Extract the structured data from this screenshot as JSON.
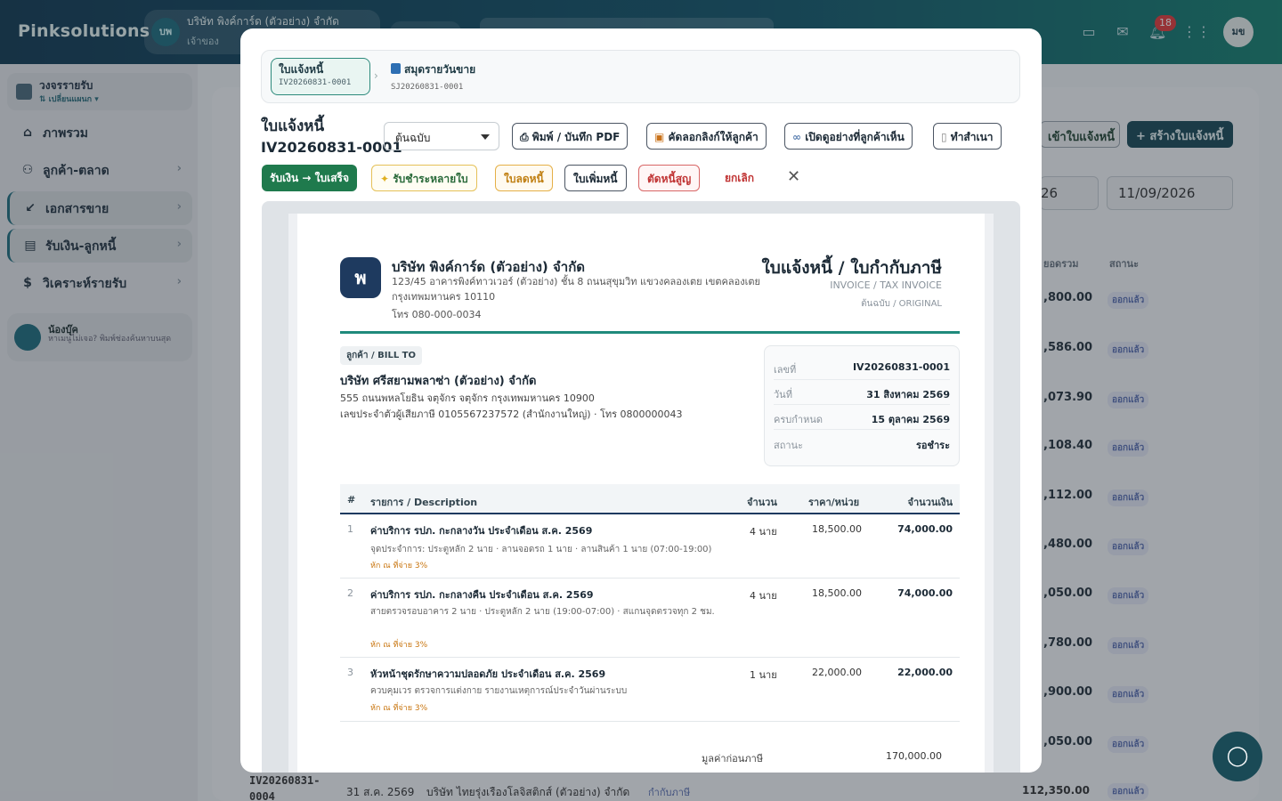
{
  "app": {
    "brand": "Pinksolutions",
    "company_avatar": "บพ",
    "company_name": "บริษัท พิงค์การ์ด (ตัวอย่าง) จำกัด",
    "company_role": "เจ้าของ",
    "notification_count": "18",
    "user_avatar": "มข"
  },
  "sidebar": {
    "plan_title": "วงจรรายรับ",
    "plan_switch": "⇅ เปลี่ยนแผนก ▾",
    "items": [
      {
        "label": "ภาพรวม",
        "icon": "home-icon"
      },
      {
        "label": "ลูกค้า-ตลาด",
        "icon": "users-icon"
      },
      {
        "label": "เอกสารขาย",
        "icon": "arrow-down-left-icon"
      },
      {
        "label": "รับเงิน-ลูกหนี้",
        "icon": "receipt-icon"
      },
      {
        "label": "วิเคราะห์รายรับ",
        "icon": "dollar-doc-icon"
      }
    ],
    "help_title": "น้องบุ๊ค",
    "help_sub": "หาเมนูไม่เจอ? พิมพ์ช่องค้นหาบนสุด"
  },
  "background": {
    "btn_import": "เข้าใบแจ้งหนี้",
    "btn_create": "+ สร้างใบแจ้งหนี้",
    "date_from": "26",
    "date_to": "11/09/2026",
    "col_total": "ยอดรวม",
    "col_status": "สถานะ",
    "amounts": [
      ",800.00",
      ",586.00",
      ",073.90",
      ",108.40",
      ",112.00",
      ",480.00",
      ",050.00",
      ",780.00",
      ",900.00",
      ",050.00"
    ],
    "status": "ออกแล้ว",
    "bottom_row": {
      "doc_no": "IV20260831-0004",
      "date": "31 ส.ค. 2569",
      "customer": "บริษัท ไทยรุ่งเรืองโลจิสติกส์ (ตัวอย่าง) จำกัด",
      "tag": "กำกับภาษี",
      "amount": "112,350.00",
      "status": "ออกแล้ว"
    }
  },
  "modal": {
    "crumb_current_title": "ใบแจ้งหนี้",
    "crumb_current_no": "IV20260831-0001",
    "crumb_link_title": "สมุดรายวันขาย",
    "crumb_link_no": "SJ20260831-0001",
    "title": "ใบแจ้งหนี้",
    "doc_no": "IV20260831-0001",
    "copy_select": "ต้นฉบับ",
    "toolbar": {
      "print": "พิมพ์ / บันทึก PDF",
      "copy_link": "คัดลอกลิงก์ให้ลูกค้า",
      "open_preview": "เปิดดูอย่างที่ลูกค้าเห็น",
      "duplicate": "ทำสำเนา"
    },
    "actions": {
      "receive": "รับเงิน → ใบเสร็จ",
      "multi": "รับชำระหลายใบ",
      "credit": "ใบลดหนี้",
      "debit": "ใบเพิ่มหนี้",
      "writeoff": "ตัดหนี้สูญ",
      "cancel": "ยกเลิก"
    }
  },
  "invoice": {
    "logo": "พ",
    "company": "บริษัท พิงค์การ์ด (ตัวอย่าง) จำกัด",
    "address": "123/45 อาคารพิงค์ทาวเวอร์ (ตัวอย่าง) ชั้น 8 ถนนสุขุมวิท แขวงคลองเตย เขตคลองเตย กรุงเทพมหานคร 10110",
    "tel": "โทร 080-000-0034",
    "title": "ใบแจ้งหนี้ / ใบกำกับภาษี",
    "subtitle": "INVOICE / TAX INVOICE",
    "original": "ต้นฉบับ / ORIGINAL",
    "billto_tag": "ลูกค้า / BILL TO",
    "customer_name": "บริษัท ศรีสยามพลาซ่า (ตัวอย่าง) จำกัด",
    "customer_addr": "555 ถนนพหลโยธิน จตุจักร จตุจักร กรุงเทพมหานคร 10900",
    "customer_tax": "เลขประจำตัวผู้เสียภาษี 0105567237572 (สำนักงานใหญ่) · โทร 0800000043",
    "meta": [
      {
        "k": "เลขที่",
        "v": "IV20260831-0001"
      },
      {
        "k": "วันที่",
        "v": "31 สิงหาคม 2569"
      },
      {
        "k": "ครบกำหนด",
        "v": "15 ตุลาคม 2569"
      },
      {
        "k": "สถานะ",
        "v": "รอชำระ"
      }
    ],
    "columns": {
      "no": "#",
      "desc": "รายการ / Description",
      "qty": "จำนวน",
      "price": "ราคา/หน่วย",
      "amount": "จำนวนเงิน"
    },
    "items": [
      {
        "no": "1",
        "desc": "ค่าบริการ รปภ. กะกลางวัน ประจำเดือน ส.ค. 2569",
        "sub": "จุดประจำการ: ประตูหลัก 2 นาย · ลานจอดรถ 1 นาย · ลานสินค้า 1 นาย (07:00-19:00)",
        "wht": "หัก ณ ที่จ่าย 3%",
        "qty": "4 นาย",
        "price": "18,500.00",
        "amount": "74,000.00"
      },
      {
        "no": "2",
        "desc": "ค่าบริการ รปภ. กะกลางคืน ประจำเดือน ส.ค. 2569",
        "sub": "สายตรวจรอบอาคาร 2 นาย · ประตูหลัก 2 นาย (19:00-07:00) · สแกนจุดตรวจทุก 2 ชม.",
        "wht": "หัก ณ ที่จ่าย 3%",
        "qty": "4 นาย",
        "price": "18,500.00",
        "amount": "74,000.00"
      },
      {
        "no": "3",
        "desc": "หัวหน้าชุดรักษาความปลอดภัย ประจำเดือน ส.ค. 2569",
        "sub": "ควบคุมเวร ตรวจการแต่งกาย รายงานเหตุการณ์ประจำวันผ่านระบบ",
        "wht": "หัก ณ ที่จ่าย 3%",
        "qty": "1 นาย",
        "price": "22,000.00",
        "amount": "22,000.00"
      }
    ],
    "subtotal_label": "มูลค่าก่อนภาษี",
    "subtotal": "170,000.00"
  }
}
